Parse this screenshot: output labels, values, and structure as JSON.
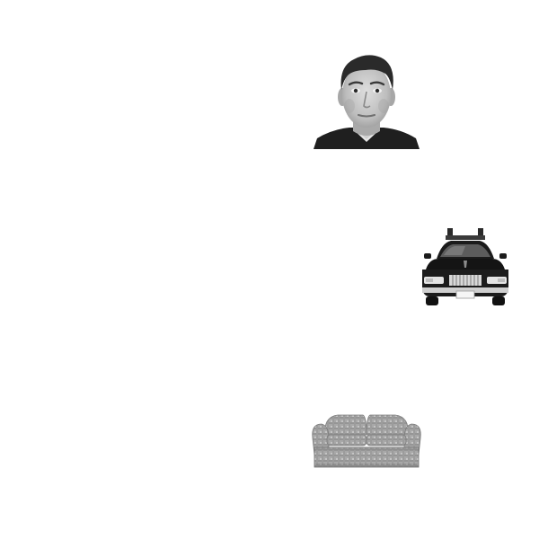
{
  "stimuli": [
    {
      "id": "face",
      "kind": "photo",
      "depicts": "man-face",
      "grayscale": true
    },
    {
      "id": "car",
      "kind": "photo",
      "depicts": "police-car-front",
      "grayscale": true
    },
    {
      "id": "sofa",
      "kind": "photo",
      "depicts": "loveseat-sofa",
      "grayscale": true
    }
  ],
  "colors": {
    "background": "#ffffff",
    "shirt": "#1e1e1e",
    "skin_light": "#d8d8d8",
    "skin_mid": "#b4b4b4",
    "hair": "#2a2a2a",
    "car_body": "#1c1c1c",
    "chrome": "#e2e2e2",
    "sofa_light": "#b8b8b8",
    "sofa_mid": "#8f8f8f",
    "sofa_dark": "#6e6e6e"
  }
}
